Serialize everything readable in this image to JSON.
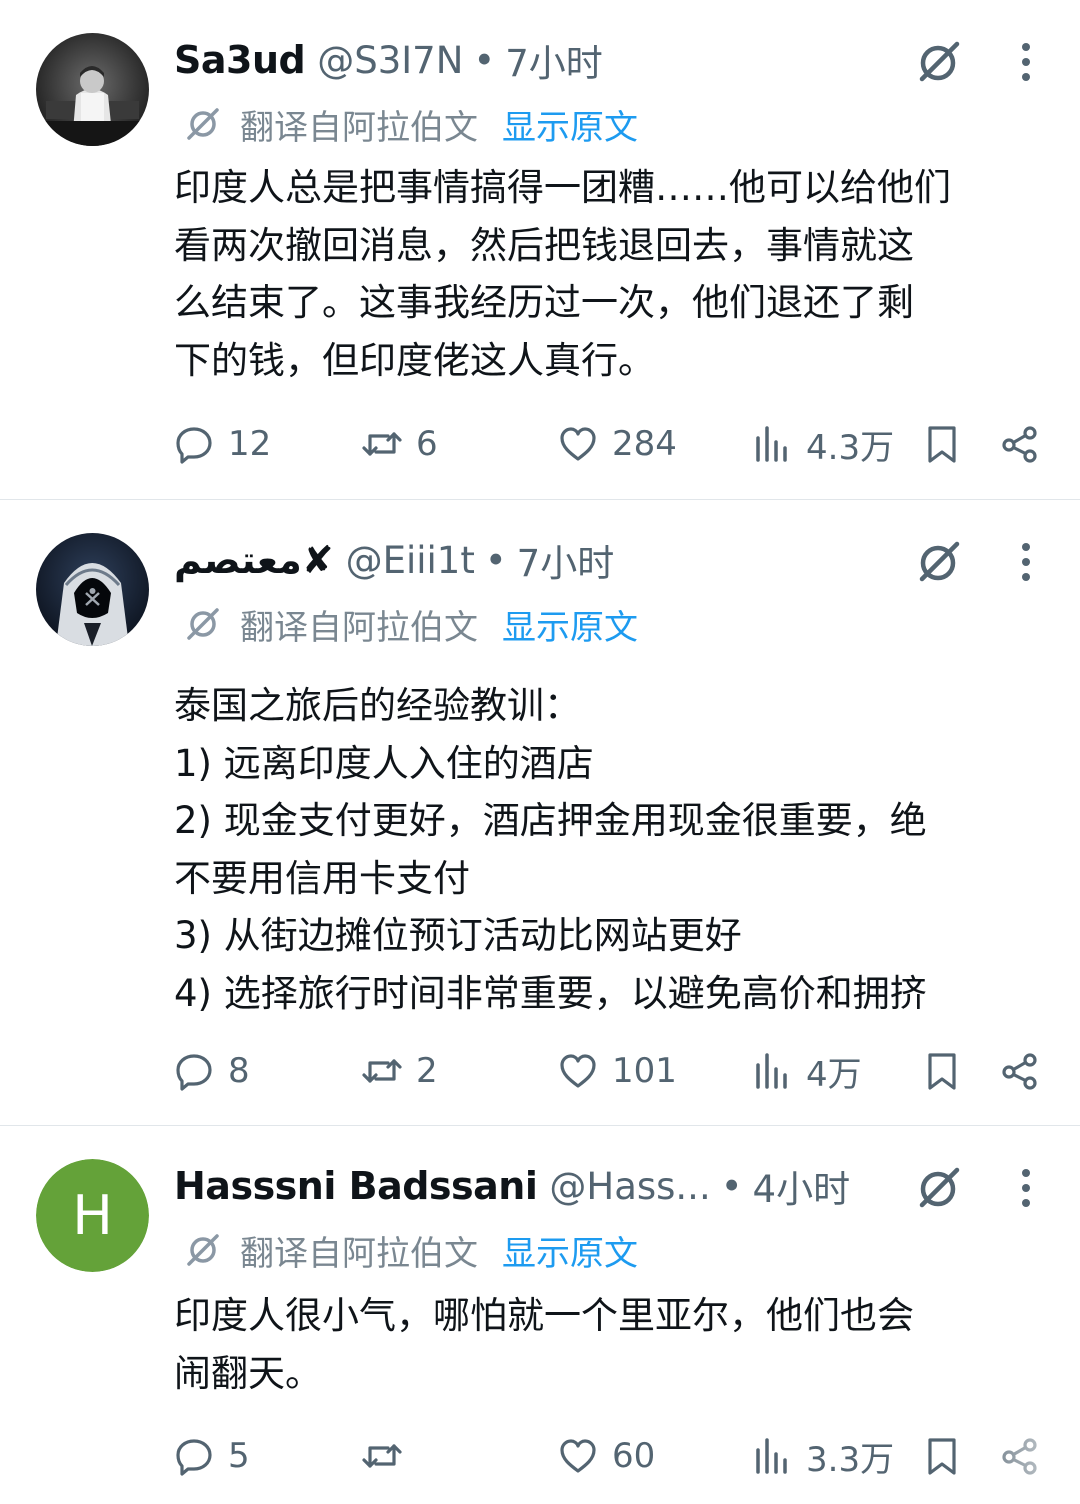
{
  "colors": {
    "link": "#1d9bf0",
    "muted": "#536471",
    "avatar_h_bg": "#64a239"
  },
  "tweets": [
    {
      "name": "Sa3ud",
      "handle": "@S3I7N",
      "separator": "•",
      "time": "7小时",
      "avatar_icon": "person-photo-avatar",
      "translated_from": "翻译自阿拉伯文",
      "show_original": "显示原文",
      "lines": [
        "印度人总是把事情搞得一团糟……他可以给他们",
        "看两次撤回消息，然后把钱退回去，事情就这",
        "么结束了。这事我经历过一次，他们退还了剩",
        "下的钱，但印度佬这人真行。"
      ],
      "replies": "12",
      "retweets": "6",
      "likes": "284",
      "views": "4.3万"
    },
    {
      "name": "معتصم✘",
      "handle": "@Eiii1t",
      "separator": "•",
      "time": "7小时",
      "avatar_icon": "hooded-figure-avatar",
      "translated_from": "翻译自阿拉伯文",
      "show_original": "显示原文",
      "lines": [
        "泰国之旅后的经验教训：",
        "1) 远离印度人入住的酒店",
        "2) 现金支付更好，酒店押金用现金很重要，绝",
        "不要用信用卡支付",
        "3) 从街边摊位预订活动比网站更好",
        "4) 选择旅行时间非常重要，以避免高价和拥挤"
      ],
      "replies": "8",
      "retweets": "2",
      "likes": "101",
      "views": "4万"
    },
    {
      "name": "Hasssni Badssani",
      "handle": "@Hass...",
      "separator": "•",
      "time": "4小时",
      "avatar_letter": "H",
      "translated_from": "翻译自阿拉伯文",
      "show_original": "显示原文",
      "lines": [
        "印度人很小气，哪怕就一个里亚尔，他们也会",
        "闹翻天。"
      ],
      "replies": "5",
      "retweets": "",
      "likes": "60",
      "views": "3.3万"
    }
  ]
}
